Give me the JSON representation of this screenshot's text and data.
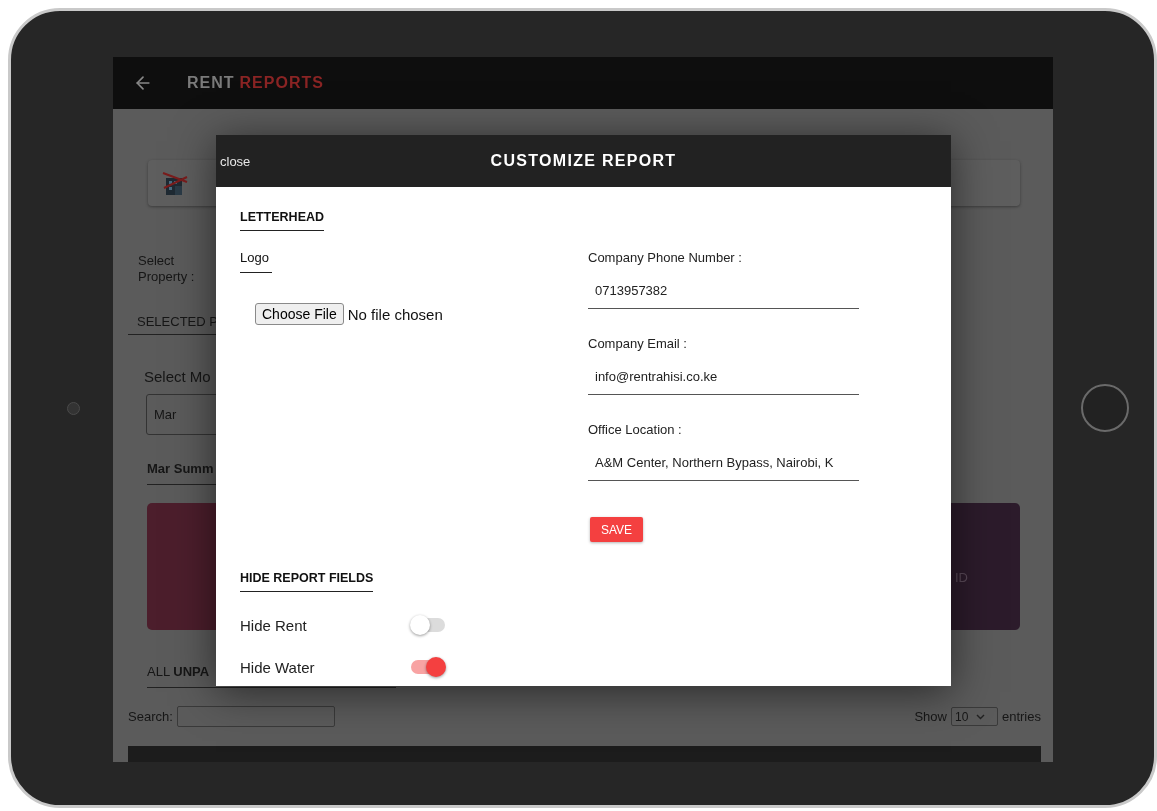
{
  "header": {
    "title": "RENT",
    "title_accent": "REPORTS"
  },
  "background": {
    "select_property_label": "Select Property :",
    "selected_property_tab": "SELECTED P",
    "select_month_label": "Select Mo",
    "month_value": "Mar",
    "summary_heading": "Mar Summ",
    "card_text": "ID",
    "unpaid_heading": "ALL **UNPA**",
    "search_label": "Search:",
    "show_label": "Show",
    "entries_value": "10",
    "entries_label": "entries"
  },
  "modal": {
    "close": "close",
    "title": "CUSTOMIZE REPORT",
    "letterhead_heading": "LETTERHEAD",
    "logo_label": "Logo",
    "file_button": "Choose File",
    "file_status": "No file chosen",
    "fields": [
      {
        "label": "Company Phone Number :",
        "value": "0713957382"
      },
      {
        "label": "Company Email :",
        "value": "info@rentrahisi.co.ke"
      },
      {
        "label": "Office Location :",
        "value": "A&M Center, Northern Bypass, Nairobi, K"
      }
    ],
    "save": "SAVE",
    "hide_heading": "HIDE REPORT FIELDS",
    "toggles": [
      {
        "label": "Hide Rent",
        "on": false
      },
      {
        "label": "Hide Water",
        "on": true
      }
    ]
  }
}
